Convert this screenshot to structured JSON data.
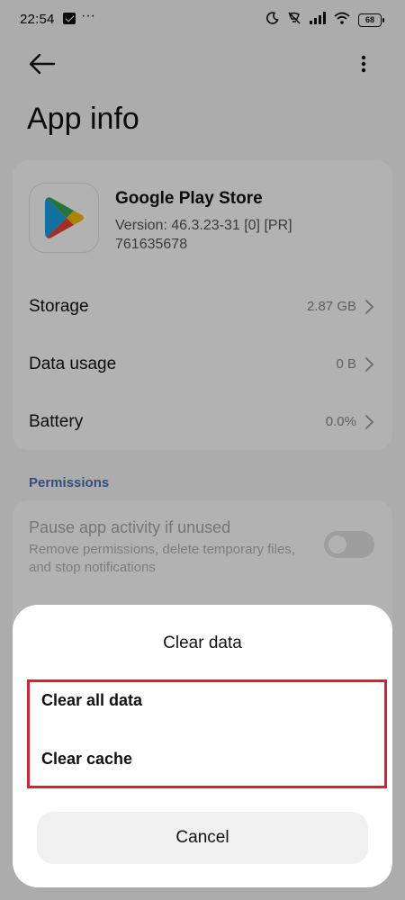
{
  "status_bar": {
    "time": "22:54",
    "more_indicator": "···",
    "battery_level": "68"
  },
  "header": {
    "title": "App info"
  },
  "app": {
    "name": "Google Play Store",
    "version": "Version: 46.3.23-31 [0] [PR] 761635678",
    "icon": "google-play-icon"
  },
  "rows": [
    {
      "label": "Storage",
      "value": "2.87 GB"
    },
    {
      "label": "Data usage",
      "value": "0 B"
    },
    {
      "label": "Battery",
      "value": "0.0%"
    }
  ],
  "permissions": {
    "section_title": "Permissions",
    "pause_title": "Pause app activity if unused",
    "pause_desc": "Remove permissions, delete temporary files, and stop notifications",
    "toggle_on": false
  },
  "dialog": {
    "title": "Clear data",
    "options": [
      "Clear all data",
      "Clear cache"
    ],
    "cancel_label": "Cancel",
    "highlight_color": "#d7232f"
  },
  "colors": {
    "accent": "#4a6fb5"
  }
}
